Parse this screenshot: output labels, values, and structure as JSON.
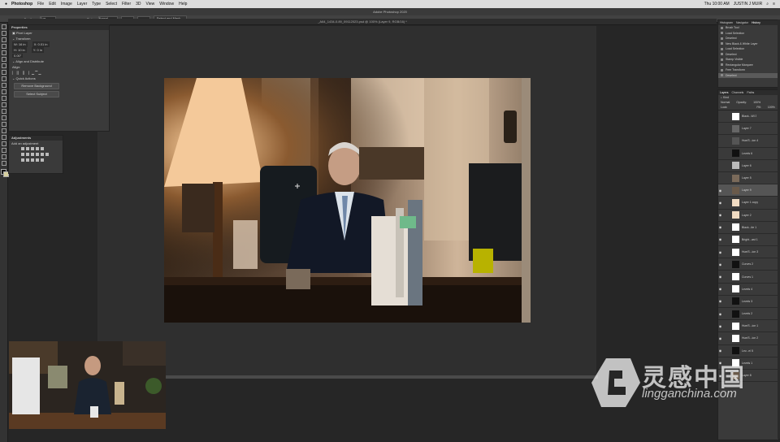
{
  "menubar": {
    "apple": "",
    "app_name": "Photoshop",
    "menus": [
      "File",
      "Edit",
      "Image",
      "Layer",
      "Type",
      "Select",
      "Filter",
      "3D",
      "View",
      "Window",
      "Help"
    ],
    "datetime": "Thu 10:00 AM",
    "user": "JUSTIN J MUIR"
  },
  "window": {
    "title": "Adobe Photoshop 2020",
    "doc_tab": "_A64_1434-0.89_09112023.psd @ 100% (Layer 9, RGB/16) *"
  },
  "options": {
    "feather_label": "Feather:",
    "feather_value": "0 px",
    "style_label": "Style:",
    "style_value": "Normal",
    "select_mask_button": "Select and Mask..."
  },
  "properties": {
    "title": "Properties",
    "layer_kind": "Pixel Layer",
    "transform_label": "Transform",
    "w": "W: 16 in",
    "h": "H: 10 in",
    "x": "X: 0.01 in",
    "y": "Y: 0 in",
    "angle": "0.00°",
    "align_label": "Align and Distribute",
    "align_sub": "Align:",
    "quick_actions_label": "Quick Actions",
    "remove_bg_button": "Remove Background",
    "select_subject_button": "Select Subject"
  },
  "adjustments": {
    "title": "Adjustments",
    "subtitle": "Add an adjustment"
  },
  "history": {
    "tabs": [
      "Histogram",
      "Navigator",
      "History"
    ],
    "items": [
      "Brush Tool",
      "Load Selection",
      "Deselect",
      "New Black & White Layer",
      "Load Selection",
      "Deselect",
      "Stamp Visible",
      "Rectangular Marquee",
      "Free Transform",
      "Deselect"
    ],
    "selected_index": 9
  },
  "layers": {
    "tabs": [
      "Layers",
      "Channels",
      "Paths"
    ],
    "kind_label": "Kind",
    "blend_mode": "Normal",
    "opacity_label": "Opacity:",
    "opacity_value": "100%",
    "lock_label": "Lock:",
    "fill_label": "Fill:",
    "fill_value": "100%",
    "items": [
      {
        "name": "Black...Wl 3",
        "visible": false
      },
      {
        "name": "Layer 7",
        "visible": false
      },
      {
        "name": "Hue/S...ion 4",
        "visible": false
      },
      {
        "name": "Levels 6",
        "visible": false
      },
      {
        "name": "Layer 6",
        "visible": false
      },
      {
        "name": "Layer 5",
        "visible": false
      },
      {
        "name": "Layer 9",
        "visible": true
      },
      {
        "name": "Layer 1 copy",
        "visible": true
      },
      {
        "name": "Layer 2",
        "visible": true
      },
      {
        "name": "Black...ite 1",
        "visible": true
      },
      {
        "name": "Bright...ast 1",
        "visible": true
      },
      {
        "name": "Hue/S...ion 3",
        "visible": true
      },
      {
        "name": "Curves 2",
        "visible": true
      },
      {
        "name": "Curves 1",
        "visible": true
      },
      {
        "name": "Levels 4",
        "visible": true
      },
      {
        "name": "Levels 3",
        "visible": true
      },
      {
        "name": "Levels 2",
        "visible": true
      },
      {
        "name": "Hue/S...ion 1",
        "visible": true
      },
      {
        "name": "Hue/S...ion 2",
        "visible": true
      },
      {
        "name": "Lev...el 5",
        "visible": true
      },
      {
        "name": "Levels 1",
        "visible": true
      },
      {
        "name": "Layer 8",
        "visible": true
      }
    ],
    "selected_index": 6
  },
  "watermark": {
    "cn": "灵感中国",
    "en": "lingganchina.com"
  },
  "colors": {
    "panel_bg": "#3a3a3a",
    "canvas_bg": "#2f2f2f",
    "selected_row": "#555555"
  }
}
